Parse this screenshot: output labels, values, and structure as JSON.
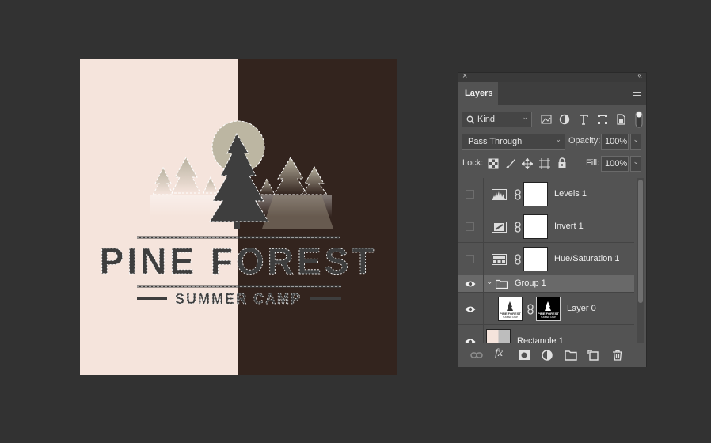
{
  "artwork": {
    "title": "PINE FOREST",
    "subtitle": "SUMMER CAMP",
    "colors": {
      "light": "#f5e4dc",
      "dark": "#33241e",
      "ink": "#3d3d3d"
    }
  },
  "layers_panel": {
    "close_glyph": "×",
    "collapse_glyph": "‹‹",
    "tab_label": "Layers",
    "filter": {
      "value": "Kind"
    },
    "blend_mode": {
      "value": "Pass Through"
    },
    "opacity": {
      "label": "Opacity:",
      "value": "100%"
    },
    "lock": {
      "label": "Lock:"
    },
    "fill": {
      "label": "Fill:",
      "value": "100%"
    },
    "layers": [
      {
        "name": "Levels 1",
        "type": "adjustment",
        "icon": "levels-icon",
        "visible": false
      },
      {
        "name": "Invert 1",
        "type": "adjustment",
        "icon": "invert-icon",
        "visible": false
      },
      {
        "name": "Hue/Saturation 1",
        "type": "adjustment",
        "icon": "hue-saturation-icon",
        "visible": false
      },
      {
        "name": "Group 1",
        "type": "group",
        "icon": "folder-icon",
        "visible": true,
        "expanded": true
      },
      {
        "name": "Layer 0",
        "type": "pixel",
        "icon": "layer-thumbnail",
        "visible": true
      },
      {
        "name": "Rectangle 1",
        "type": "shape",
        "icon": "rectangle-thumbnail",
        "visible": true
      }
    ],
    "thumb_text": {
      "title": "PINE FOREST",
      "subtitle": "SUMMER CAMP"
    }
  }
}
